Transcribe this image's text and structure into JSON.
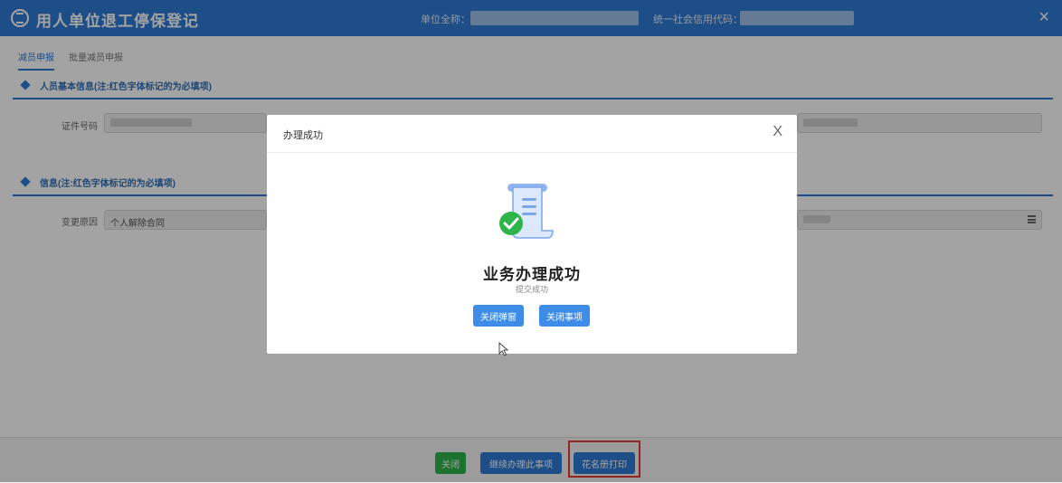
{
  "window": {
    "title": "用人单位退工停保登记",
    "unit_label": "单位全称：",
    "code_label": "统一社会信用代码：",
    "close_glyph": "×"
  },
  "tabs": [
    {
      "label": "减员申报",
      "active": true
    },
    {
      "label": "批量减员申报",
      "active": false
    }
  ],
  "sections": {
    "basic": "人员基本信息(注:红色字体标记的为必填项)",
    "info": "信息(注:红色字体标记的为必填项)"
  },
  "fields": {
    "id_number_label": "证件号码",
    "change_reason_label": "变更原因",
    "change_reason_value": "个人解除合同"
  },
  "footer": {
    "close": "关闭",
    "continue": "继续办理此事项",
    "print": "花名册打印"
  },
  "modal": {
    "title": "办理成功",
    "close_glyph": "X",
    "heading": "业务办理成功",
    "subtext": "提交成功",
    "btn_close_popup": "关闭弹窗",
    "btn_close_item": "关闭事项"
  },
  "colors": {
    "primary": "#2f7bd3",
    "success": "#2db54a",
    "highlight": "#e53935"
  }
}
